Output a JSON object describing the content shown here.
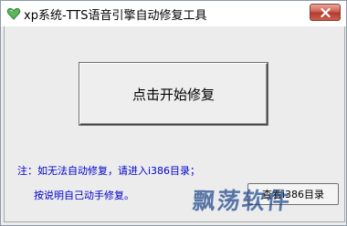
{
  "window": {
    "title": "xp系统-TTS语音引擎自动修复工具",
    "icon": "green-heart-icon",
    "close_icon": "close-icon"
  },
  "main": {
    "start_button_label": "点击开始修复",
    "note_line1": "注：如无法自动修复，请进入i386目录；",
    "note_line2": "按说明自己动手修复。",
    "help_button_label": "查看i386目录"
  },
  "watermark": {
    "text": "飘荡软件"
  },
  "colors": {
    "note_text": "#0000cc",
    "close_button": "#c9584a",
    "app_icon": "#5cb85c"
  }
}
